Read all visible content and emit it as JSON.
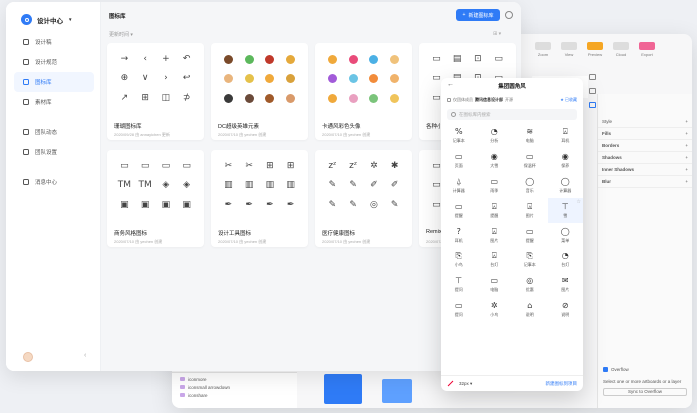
{
  "colors": {
    "accent": "#2f7bf6"
  },
  "sidebar": {
    "brand": "设计中心",
    "items": [
      {
        "label": "设计稿",
        "icon": "document-icon",
        "active": false
      },
      {
        "label": "设计规范",
        "icon": "rules-icon",
        "active": false
      },
      {
        "label": "图标库",
        "icon": "icon-library-icon",
        "active": true
      },
      {
        "label": "素材库",
        "icon": "assets-icon",
        "active": false
      }
    ],
    "team_items": [
      {
        "label": "团队动态",
        "icon": "activity-icon"
      },
      {
        "label": "团队设置",
        "icon": "settings-icon"
      }
    ],
    "messages": "消息中心"
  },
  "header": {
    "title": "图标库",
    "new_button": "新建图标库",
    "sort": "更新时间"
  },
  "cards": [
    {
      "title": "珊瑚图标库",
      "meta": "2020/09/28 由 annayichen 更新",
      "icons": [
        "→",
        "‹",
        "+",
        "↶",
        "⊕",
        "∨",
        "›",
        "↩",
        "↗",
        "⊞",
        "◫",
        "⊅"
      ],
      "emoji": false
    },
    {
      "title": "DC超级英雄元素",
      "meta": "2020/07/10 由 yechen 创建",
      "emoji": true,
      "palette": [
        "#7a4a2a",
        "#5cb85c",
        "#c0392b",
        "#e5a93b",
        "#e9b57d",
        "#e5c14a",
        "#f0a93b",
        "#d9a13b",
        "#3a3a3a",
        "#6b4a3a",
        "#a05a2a",
        "#d99a6a"
      ]
    },
    {
      "title": "卡通风彩色头像",
      "meta": "2020/07/10 由 yechen 创建",
      "emoji": true,
      "palette": [
        "#f0a93b",
        "#e94b7a",
        "#4bb0e5",
        "#f0c27b",
        "#a25bd9",
        "#6bc4e5",
        "#f28c3b",
        "#f0b36b",
        "#f0a93b",
        "#e9a0c0",
        "#7bc47b",
        "#f0c45b"
      ]
    },
    {
      "title": "各种小图标",
      "meta": "",
      "icons": [
        "▭",
        "▤",
        "⊡",
        "▭",
        "▭",
        "▤",
        "⊡",
        "▭",
        "▭",
        "▤",
        "⊡",
        "▭"
      ],
      "emoji": false
    },
    {
      "title": "商务风格图标",
      "meta": "2020/07/10 由 yechen 创建",
      "icons": [
        "▭",
        "▭",
        "▭",
        "▭",
        "TM",
        "TM",
        "◈",
        "◈",
        "▣",
        "▣",
        "▣",
        "▣"
      ],
      "emoji": false
    },
    {
      "title": "设计工具图标",
      "meta": "2020/07/10 由 yechen 创建",
      "icons": [
        "✂",
        "✂",
        "⊞",
        "⊞",
        "▥",
        "▥",
        "▥",
        "▥",
        "✒",
        "✒",
        "✒",
        "✒"
      ],
      "emoji": false
    },
    {
      "title": "医疗健康图标",
      "meta": "2020/07/10 由 yechen 创建",
      "icons": [
        "zᶻ",
        "zᶻ",
        "✲",
        "✱",
        "✎",
        "✎",
        "✐",
        "✐",
        "✎",
        "✎",
        "◎",
        "✎"
      ],
      "emoji": false
    },
    {
      "title": "Remix",
      "meta": "2020/07/10",
      "icons": [
        "▭",
        "▭",
        "▭",
        "▭",
        "▭",
        "▭",
        "▭",
        "▭",
        "▭",
        "▭",
        "▭",
        "▭"
      ],
      "emoji": false
    }
  ],
  "panel": {
    "title": "集团圆角风",
    "sub_prefix": "仅团体成员",
    "sub_owner": "腾讯信息设计部",
    "sub_suffix": "开源",
    "added": "已收藏",
    "search_placeholder": "在图标库内搜索",
    "size": "32px",
    "add_link": "新建图标到项目",
    "icons": [
      {
        "g": "%",
        "l": "记事本"
      },
      {
        "g": "◔",
        "l": "分析"
      },
      {
        "g": "≋",
        "l": "电脑"
      },
      {
        "g": "⍓",
        "l": "耳机"
      },
      {
        "g": "▭",
        "l": "页面"
      },
      {
        "g": "◉",
        "l": "大雪"
      },
      {
        "g": "▭",
        "l": "保温杯"
      },
      {
        "g": "◉",
        "l": "保养"
      },
      {
        "g": "⍙",
        "l": "计算器"
      },
      {
        "g": "▭",
        "l": "雨季"
      },
      {
        "g": "◯",
        "l": "音乐"
      },
      {
        "g": "◯",
        "l": "计算器"
      },
      {
        "g": "▭",
        "l": "提醒"
      },
      {
        "g": "⍓",
        "l": "提醒"
      },
      {
        "g": "⍓",
        "l": "图片"
      },
      {
        "g": "⊤",
        "l": "雪"
      },
      {
        "g": "?",
        "l": "耳机"
      },
      {
        "g": "⍓",
        "l": "图片"
      },
      {
        "g": "▭",
        "l": "提醒"
      },
      {
        "g": "◯",
        "l": "菜单"
      },
      {
        "g": "⎘",
        "l": "小鸟"
      },
      {
        "g": "⍓",
        "l": "台灯"
      },
      {
        "g": "⎘",
        "l": "记事本"
      },
      {
        "g": "◔",
        "l": "台灯"
      },
      {
        "g": "⊤",
        "l": "提问"
      },
      {
        "g": "▭",
        "l": "电脑"
      },
      {
        "g": "◎",
        "l": "优惠"
      },
      {
        "g": "✉",
        "l": "图片"
      },
      {
        "g": "▭",
        "l": "提问"
      },
      {
        "g": "✲",
        "l": "小鸟"
      },
      {
        "g": "⌂",
        "l": "说明"
      },
      {
        "g": "⊘",
        "l": "说明"
      }
    ]
  },
  "bgapp": {
    "toolbar": [
      "Zoom",
      "View",
      "Preview",
      "Cloud",
      "Export"
    ],
    "zoom": "27%",
    "inspector": [
      {
        "label": "Style",
        "expander": "+"
      },
      {
        "label": "Fills",
        "expander": "+"
      },
      {
        "label": "Borders",
        "expander": "+"
      },
      {
        "label": "Shadows",
        "expander": "+"
      },
      {
        "label": "Inner Shadows",
        "expander": "+"
      },
      {
        "label": "Blur",
        "expander": "+"
      }
    ],
    "layers": [
      "iconmore",
      "iconsmall arrowdown",
      "iconshare"
    ],
    "overflow_title": "Overflow",
    "overflow_text": "Select one or more artboards or a layer",
    "overflow_button": "Sync to Overflow"
  }
}
